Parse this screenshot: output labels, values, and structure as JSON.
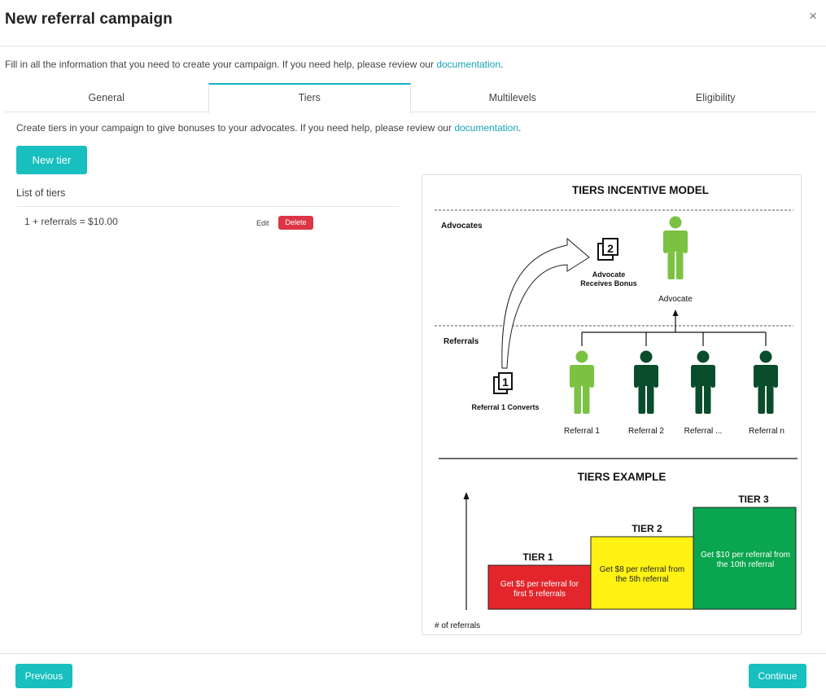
{
  "header": {
    "title": "New referral campaign",
    "close_glyph": "×"
  },
  "intro": {
    "text": "Fill in all the information that you need to create your campaign. If you need help, please review our ",
    "link": "documentation",
    "suffix": "."
  },
  "tabs": [
    {
      "label": "General",
      "active": false
    },
    {
      "label": "Tiers",
      "active": true
    },
    {
      "label": "Multilevels",
      "active": false
    },
    {
      "label": "Eligibility",
      "active": false
    }
  ],
  "tiers_panel": {
    "description": "Create tiers in your campaign to give bonuses to your advocates. If you need help, please review our ",
    "link": "documentation",
    "suffix": ".",
    "new_tier_label": "New tier",
    "list_title": "List of tiers",
    "tiers": [
      {
        "label": "1 + referrals = $10.00",
        "edit_label": "Edit",
        "delete_label": "Delete"
      }
    ]
  },
  "diagram": {
    "model_title": "TIERS INCENTIVE MODEL",
    "advocates_label": "Advocates",
    "referrals_label": "Referrals",
    "step2_number": "2",
    "step2_label_line1": "Advocate",
    "step2_label_line2": "Receives Bonus",
    "advocate_label": "Advocate",
    "step1_number": "1",
    "step1_label": "Referral 1 Converts",
    "referral_labels": [
      "Referral 1",
      "Referral 2",
      "Referral ...",
      "Referral n"
    ],
    "example_title": "TIERS EXAMPLE",
    "y_axis_label": "# of referrals",
    "tiers": [
      {
        "title": "TIER 1",
        "text_line1": "Get $5 per referral for",
        "text_line2": "first 5 referrals",
        "color": "#e3262b"
      },
      {
        "title": "TIER 2",
        "text_line1": "Get $8 per referral from",
        "text_line2": "the 5th referral",
        "color": "#fff214"
      },
      {
        "title": "TIER 3",
        "text_line1": "Get $10 per referral from",
        "text_line2": "the 10th referral",
        "color": "#0aa54f"
      }
    ],
    "colors": {
      "light_green": "#7cc242",
      "dark_green": "#0a4d2c"
    }
  },
  "footer": {
    "previous_label": "Previous",
    "continue_label": "Continue"
  },
  "colors": {
    "accent": "#17bfbf",
    "link": "#17a2b8",
    "danger": "#dc3545",
    "tab_active": "#17b3c8"
  }
}
